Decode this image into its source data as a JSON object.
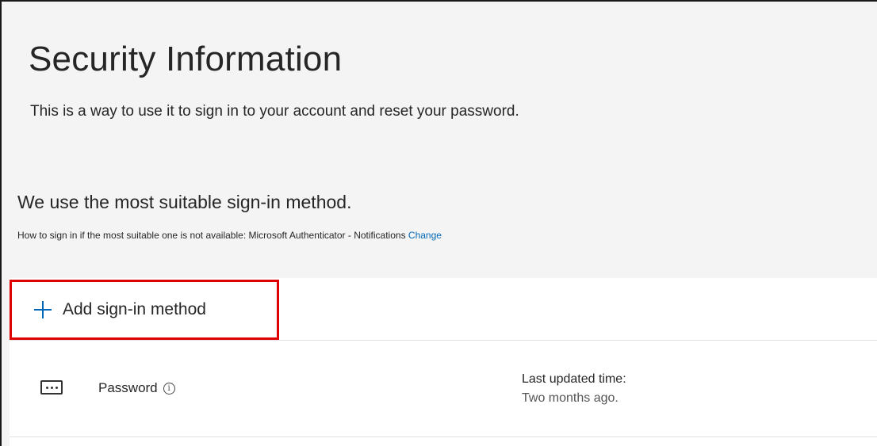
{
  "header": {
    "title": "Security Information",
    "description": "This is a way to use it to sign in to your account and reset your password."
  },
  "default_method": {
    "heading": "We use the most suitable sign-in method.",
    "fallback_text": "How to sign in if the most suitable one is not available: Microsoft Authenticator - Notifications",
    "change_link": "Change"
  },
  "add_method": {
    "label": "Add sign-in method",
    "icon": "plus-icon"
  },
  "methods": [
    {
      "name": "Password",
      "icon": "password-dots-icon",
      "info_glyph": "i",
      "detail_label": "Last updated time:",
      "detail_value": "Two months ago."
    }
  ],
  "colors": {
    "accent": "#0067b8",
    "highlight_border": "#e00000",
    "page_background": "#f4f4f4",
    "card_background": "#ffffff"
  }
}
